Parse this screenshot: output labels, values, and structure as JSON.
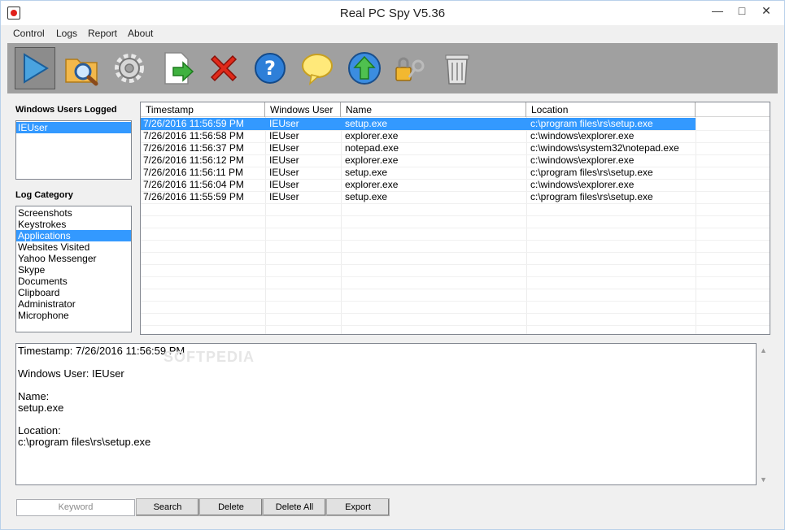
{
  "window": {
    "title": "Real PC Spy V5.36",
    "controls": {
      "minimize": "—",
      "maximize": "□",
      "close": "✕"
    }
  },
  "menu": [
    "Control",
    "Logs",
    "Report",
    "About"
  ],
  "toolbar": {
    "buttons": [
      {
        "name": "play-icon"
      },
      {
        "name": "search-folder-icon"
      },
      {
        "name": "settings-icon"
      },
      {
        "name": "export-icon"
      },
      {
        "name": "stop-icon"
      },
      {
        "name": "help-icon"
      },
      {
        "name": "chat-icon"
      },
      {
        "name": "update-icon"
      },
      {
        "name": "lock-key-icon"
      },
      {
        "name": "trash-icon"
      }
    ]
  },
  "users_panel": {
    "label": "Windows Users Logged",
    "items": [
      "IEUser"
    ],
    "selected": 0
  },
  "category_panel": {
    "label": "Log Category",
    "items": [
      "Screenshots",
      "Keystrokes",
      "Applications",
      "Websites Visited",
      "Yahoo Messenger",
      "Skype",
      "Documents",
      "Clipboard",
      "Administrator",
      "Microphone"
    ],
    "selected": 2
  },
  "grid": {
    "columns": [
      "Timestamp",
      "Windows User",
      "Name",
      "Location"
    ],
    "rows": [
      [
        "7/26/2016 11:56:59 PM",
        "IEUser",
        "setup.exe",
        "c:\\program files\\rs\\setup.exe"
      ],
      [
        "7/26/2016 11:56:58 PM",
        "IEUser",
        "explorer.exe",
        "c:\\windows\\explorer.exe"
      ],
      [
        "7/26/2016 11:56:37 PM",
        "IEUser",
        "notepad.exe",
        "c:\\windows\\system32\\notepad.exe"
      ],
      [
        "7/26/2016 11:56:12 PM",
        "IEUser",
        "explorer.exe",
        "c:\\windows\\explorer.exe"
      ],
      [
        "7/26/2016 11:56:11 PM",
        "IEUser",
        "setup.exe",
        "c:\\program files\\rs\\setup.exe"
      ],
      [
        "7/26/2016 11:56:04 PM",
        "IEUser",
        "explorer.exe",
        "c:\\windows\\explorer.exe"
      ],
      [
        "7/26/2016 11:55:59 PM",
        "IEUser",
        "setup.exe",
        "c:\\program files\\rs\\setup.exe"
      ]
    ],
    "selected": 0
  },
  "detail": {
    "timestamp_line": "Timestamp: 7/26/2016 11:56:59 PM",
    "user_line": "Windows User: IEUser",
    "name_label": "Name:",
    "name_value": "setup.exe",
    "location_label": "Location:",
    "location_value": "c:\\program files\\rs\\setup.exe"
  },
  "watermark": "SOFTPEDIA",
  "footer": {
    "keyword_placeholder": "Keyword",
    "search": "Search",
    "delete": "Delete",
    "delete_all": "Delete All",
    "export": "Export"
  },
  "colors": {
    "selection": "#3399ff",
    "toolbar_bg": "#a0a0a0"
  }
}
